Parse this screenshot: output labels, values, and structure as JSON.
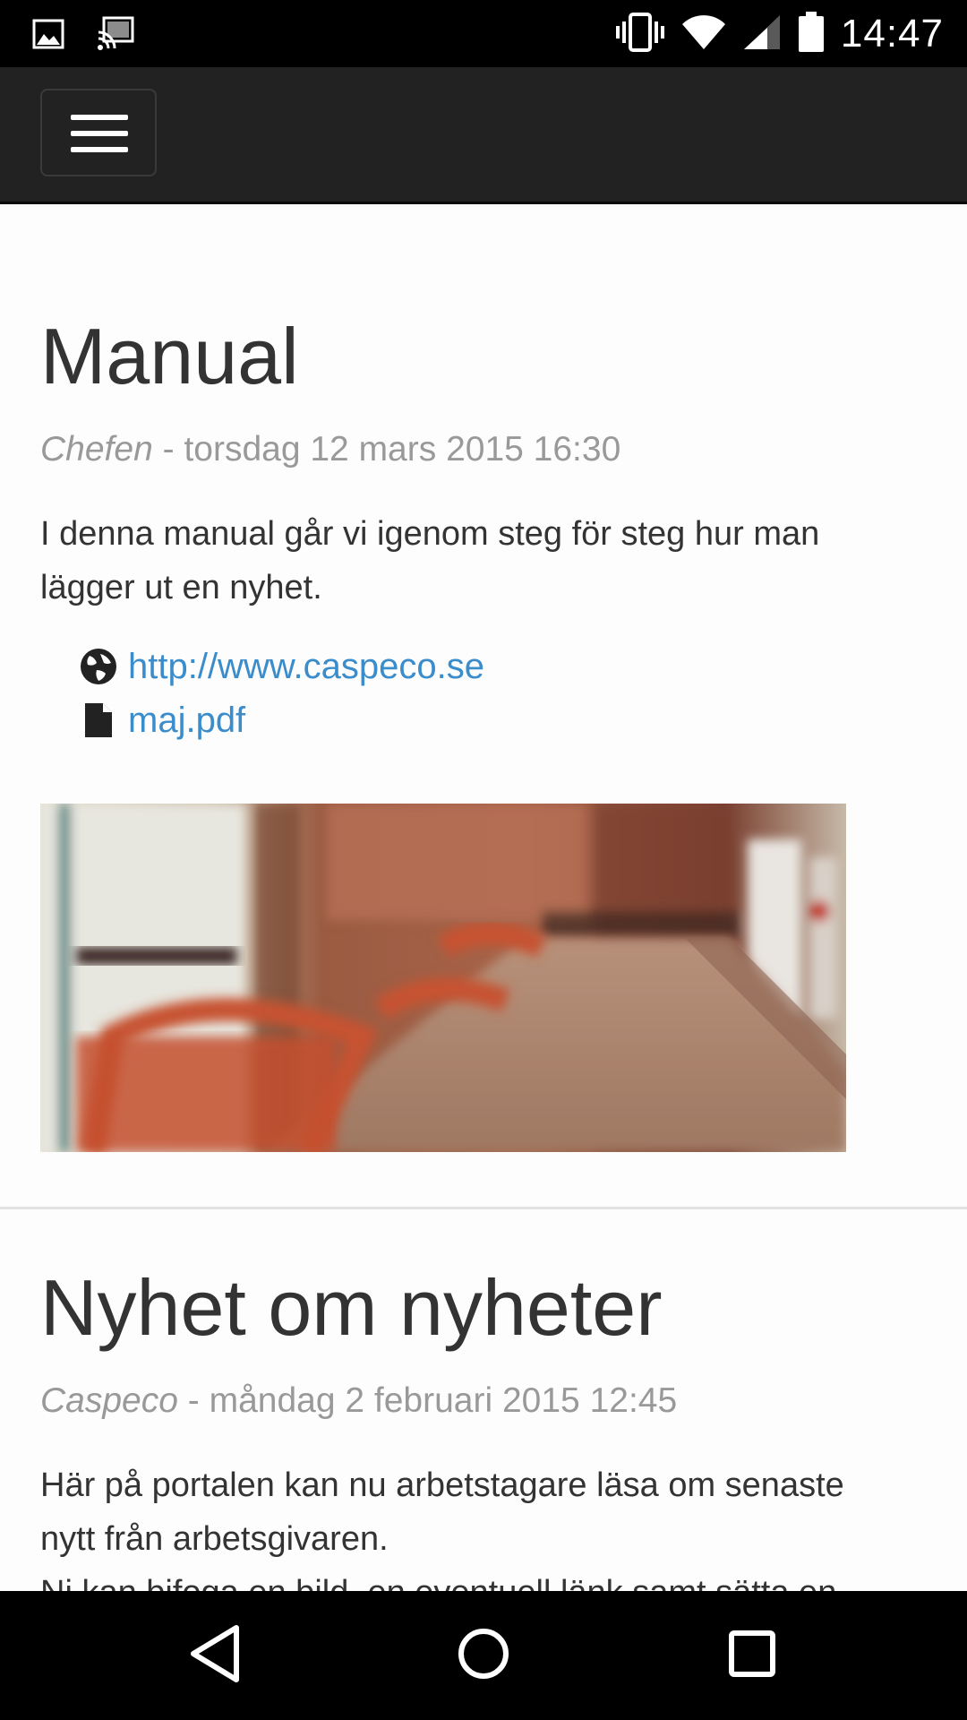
{
  "status_bar": {
    "time": "14:47",
    "icons": [
      "image-notification-icon",
      "cast-icon",
      "vibrate-icon",
      "wifi-icon",
      "signal-icon",
      "battery-icon"
    ]
  },
  "navbar": {
    "menu_icon": "hamburger-menu-icon"
  },
  "posts": [
    {
      "title": "Manual",
      "author": "Chefen",
      "separator": " - ",
      "date": "torsdag 12 mars 2015 16:30",
      "body": [
        "I denna manual går vi igenom steg för steg hur man",
        "lägger ut en nyhet."
      ],
      "links": [
        {
          "icon": "globe-icon",
          "label": "http://www.caspeco.se"
        },
        {
          "icon": "file-icon",
          "label": "maj.pdf"
        }
      ],
      "image": "cafe-table-chairs-photo"
    },
    {
      "title": "Nyhet om nyheter",
      "author": "Caspeco",
      "separator": " - ",
      "date": "måndag 2 februari 2015 12:45",
      "body": [
        "Här på portalen kan nu arbetstagare läsa om senaste",
        "nytt från arbetsgivaren.",
        "Ni kan bifoga en bild, en eventuell länk samt sätta en"
      ]
    }
  ],
  "system_nav": {
    "back_icon": "back-triangle-icon",
    "home_icon": "home-circle-icon",
    "recents_icon": "recents-square-icon"
  }
}
